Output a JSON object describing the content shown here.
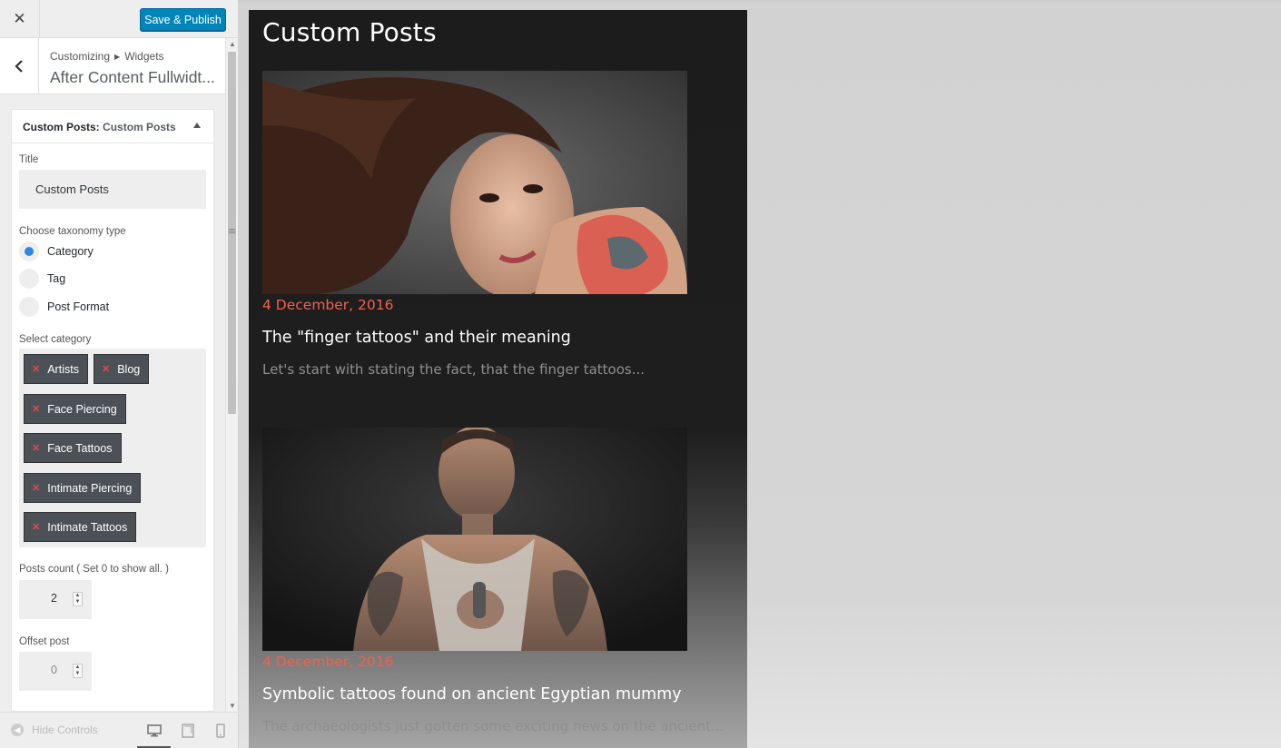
{
  "topbar": {
    "close_icon": "close-icon",
    "save_label": "Save & Publish"
  },
  "section": {
    "breadcrumb": [
      "Customizing",
      "Widgets"
    ],
    "title": "After Content Fullwidt..."
  },
  "widget": {
    "header_type": "Custom Posts:",
    "header_name": "Custom Posts",
    "title_label": "Title",
    "title_value": "Custom Posts",
    "taxonomy_label": "Choose taxonomy type",
    "taxonomy_options": [
      "Category",
      "Tag",
      "Post Format"
    ],
    "taxonomy_selected": "Category",
    "category_label": "Select category",
    "categories": [
      "Artists",
      "Blog",
      "Face Piercing",
      "Face Tattoos",
      "Intimate Piercing",
      "Intimate Tattoos"
    ],
    "posts_count_label": "Posts count ( Set 0 to show all. )",
    "posts_count_value": "2",
    "offset_label": "Offset post",
    "offset_value": "0"
  },
  "footer": {
    "hide_controls": "Hide Controls",
    "devices": [
      "desktop",
      "tablet",
      "mobile"
    ],
    "active_device": "desktop"
  },
  "preview": {
    "area_title": "Custom Posts",
    "posts": [
      {
        "date": "4 December, 2016",
        "title": "The \"finger tattoos\" and their meaning",
        "excerpt": "Let's start with stating the fact, that the finger tattoos..."
      },
      {
        "date": "4 December, 2016",
        "title": "Symbolic tattoos found on ancient Egyptian mummy",
        "excerpt": "The archaeologists just gotten some exciting news on the ancient..."
      }
    ]
  },
  "colors": {
    "accent": "#0085ba",
    "date": "#f2624a",
    "chip": "#4b5157",
    "chip_remove": "#e24a4a",
    "radio_selected": "#2f86e3"
  }
}
